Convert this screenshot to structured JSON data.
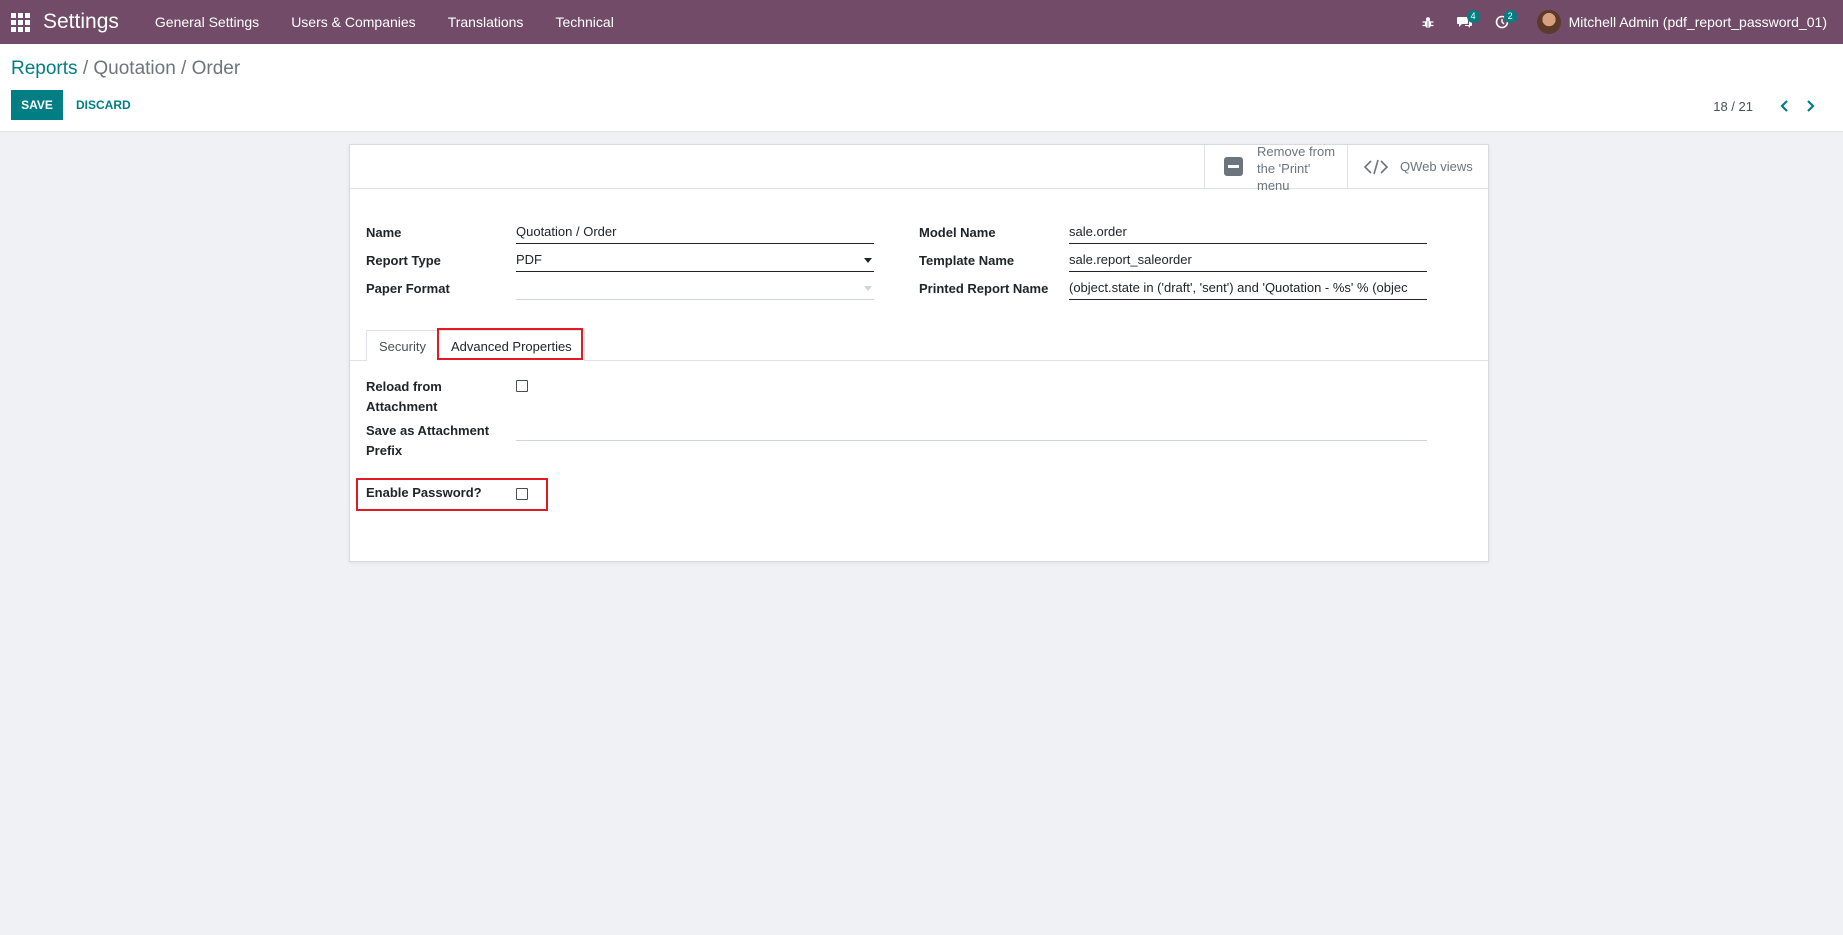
{
  "navbar": {
    "app_title": "Settings",
    "menu": [
      "General Settings",
      "Users & Companies",
      "Translations",
      "Technical"
    ],
    "messages_badge": "4",
    "activities_badge": "2",
    "user_name": "Mitchell Admin (pdf_report_password_01)"
  },
  "breadcrumb": {
    "parent": "Reports",
    "separator": "/",
    "current": "Quotation / Order"
  },
  "actions": {
    "save_label": "SAVE",
    "discard_label": "DISCARD"
  },
  "pager": {
    "value": "18 / 21"
  },
  "button_box": {
    "remove_label": "Remove from the 'Print' menu",
    "qweb_label": "QWeb views"
  },
  "form": {
    "name_label": "Name",
    "name_value": "Quotation / Order",
    "report_type_label": "Report Type",
    "report_type_value": "PDF",
    "paper_format_label": "Paper Format",
    "paper_format_value": "",
    "model_name_label": "Model Name",
    "model_name_value": "sale.order",
    "template_name_label": "Template Name",
    "template_name_value": "sale.report_saleorder",
    "printed_report_name_label": "Printed Report Name",
    "printed_report_name_value": "(object.state in ('draft', 'sent') and 'Quotation - %s' % (objec"
  },
  "tabs": {
    "security": "Security",
    "advanced": "Advanced Properties"
  },
  "advanced": {
    "reload_label": "Reload from Attachment",
    "reload_checked": false,
    "prefix_label": "Save as Attachment Prefix",
    "prefix_value": "",
    "enable_password_label": "Enable Password?",
    "enable_password_checked": false
  },
  "colors": {
    "brand": "#714b67",
    "accent": "#017e84",
    "highlight": "#e01b24"
  }
}
